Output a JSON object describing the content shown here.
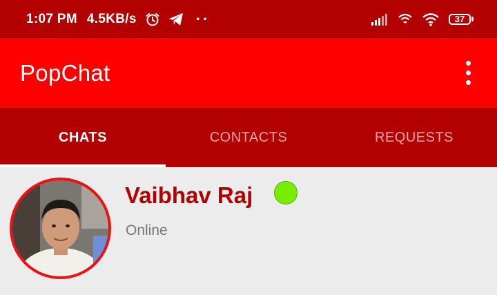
{
  "status_bar": {
    "time": "1:07 PM",
    "speed": "4.5KB/s",
    "dots": "··",
    "battery": "37",
    "icons": [
      "alarm-icon",
      "telegram-icon",
      "signal-icon",
      "wifi-calling-icon",
      "wifi-icon",
      "battery-icon"
    ]
  },
  "app_bar": {
    "title": "PopChat",
    "overflow_icon": "more-vert-icon"
  },
  "tabs": [
    {
      "label": "CHATS",
      "active": true
    },
    {
      "label": "CONTACTS",
      "active": false
    },
    {
      "label": "REQUESTS",
      "active": false
    }
  ],
  "chat": {
    "name": "Vaibhav Raj",
    "status": "Online",
    "online_color": "#77ee00"
  },
  "colors": {
    "status_bar": "#b30000",
    "app_bar": "#ff0000",
    "tab_bar": "#b30000",
    "name": "#b30000",
    "background": "#ececec"
  }
}
